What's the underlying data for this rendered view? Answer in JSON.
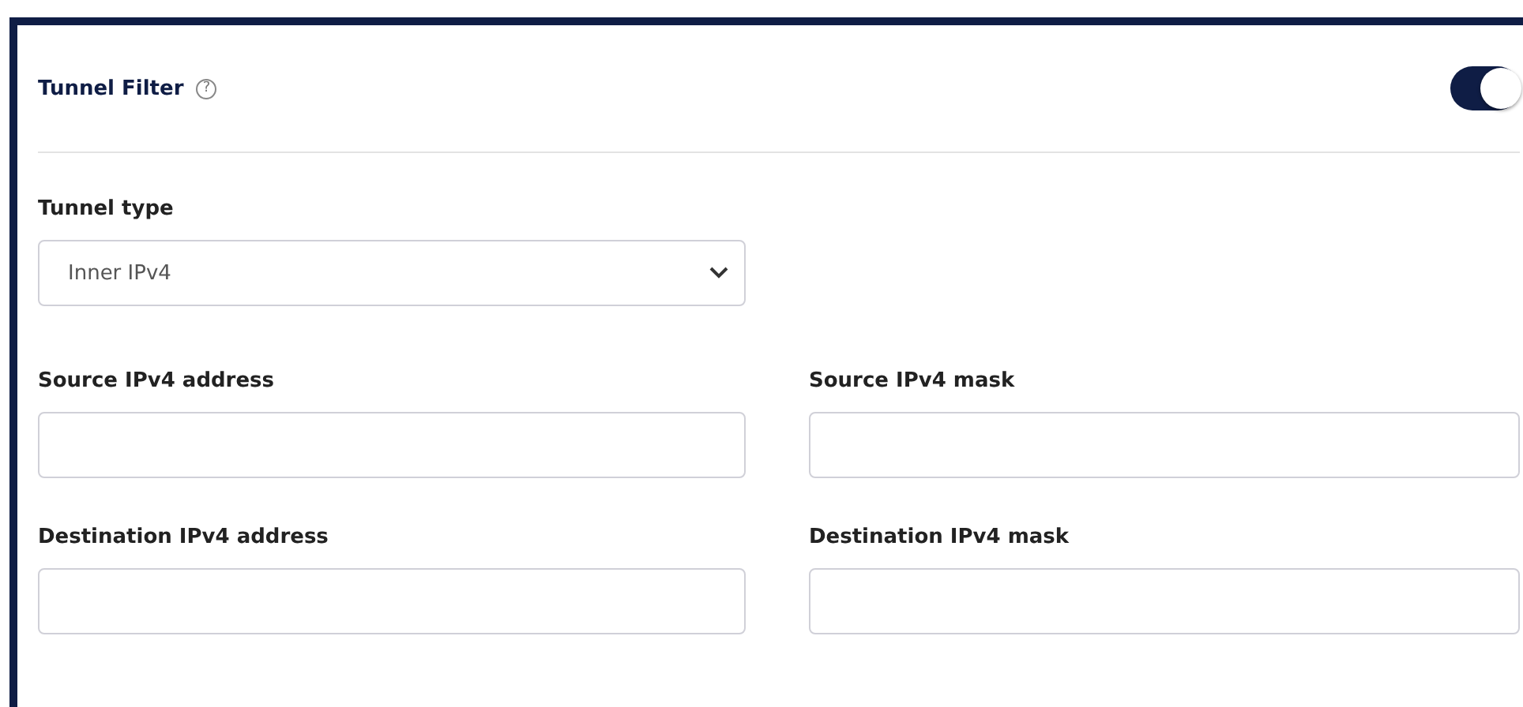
{
  "section": {
    "title": "Tunnel Filter",
    "help_icon": "?",
    "enabled": true
  },
  "tunnel_type": {
    "label": "Tunnel type",
    "value": "Inner IPv4"
  },
  "fields": [
    {
      "label": "Source IPv4 address"
    },
    {
      "label": "Source IPv4 mask"
    },
    {
      "label": "Destination IPv4 address"
    },
    {
      "label": "Destination IPv4 mask"
    }
  ]
}
